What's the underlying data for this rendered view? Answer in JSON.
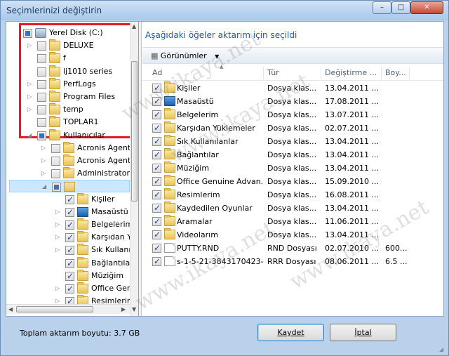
{
  "window": {
    "title": "Seçimlerinizi değiştirin",
    "min_glyph": "–",
    "max_glyph": "□",
    "close_glyph": "✕"
  },
  "tree": [
    {
      "label": "Yerel Disk (C:)",
      "indent": 0,
      "icon": "drive-icon",
      "check": "part",
      "expander": "",
      "sel": false
    },
    {
      "label": "DELUXE",
      "indent": 1,
      "icon": "folder-icon",
      "check": "off",
      "expander": "▷",
      "sel": false
    },
    {
      "label": "f",
      "indent": 1,
      "icon": "folder-icon",
      "check": "off",
      "expander": "",
      "sel": false
    },
    {
      "label": "lj1010 series",
      "indent": 1,
      "icon": "folder-icon",
      "check": "off",
      "expander": "",
      "sel": false
    },
    {
      "label": "PerfLogs",
      "indent": 1,
      "icon": "folder-icon",
      "check": "off",
      "expander": "▷",
      "sel": false
    },
    {
      "label": "Program Files",
      "indent": 1,
      "icon": "folder-icon",
      "check": "off",
      "expander": "▷",
      "sel": false
    },
    {
      "label": "temp",
      "indent": 1,
      "icon": "folder-icon",
      "check": "off",
      "expander": "▷",
      "sel": false
    },
    {
      "label": "TOPLAR1",
      "indent": 1,
      "icon": "folder-icon",
      "check": "off",
      "expander": "",
      "sel": false
    },
    {
      "label": "Kullanıcılar",
      "indent": 1,
      "icon": "folder-icon",
      "check": "part",
      "expander": "◢",
      "sel": false
    },
    {
      "label": "Acronis Agent",
      "indent": 2,
      "icon": "folder-icon",
      "check": "off",
      "expander": "▷",
      "sel": false
    },
    {
      "label": "Acronis Agent",
      "indent": 2,
      "icon": "folder-icon",
      "check": "off",
      "expander": "▷",
      "sel": false
    },
    {
      "label": "Administrator",
      "indent": 2,
      "icon": "folder-icon",
      "check": "off",
      "expander": "▷",
      "sel": false
    },
    {
      "label": "",
      "indent": 2,
      "icon": "user-folder-icon",
      "check": "part",
      "expander": "◢",
      "sel": true
    },
    {
      "label": "Kişiler",
      "indent": 3,
      "icon": "contacts-icon",
      "check": "on",
      "expander": "",
      "sel": false
    },
    {
      "label": "Masaüstü",
      "indent": 3,
      "icon": "desktop-icon",
      "check": "on",
      "expander": "▷",
      "sel": false
    },
    {
      "label": "Belgelerim",
      "indent": 3,
      "icon": "documents-icon",
      "check": "on",
      "expander": "▷",
      "sel": false
    },
    {
      "label": "Karşıdan Y",
      "indent": 3,
      "icon": "downloads-icon",
      "check": "on",
      "expander": "▷",
      "sel": false
    },
    {
      "label": "Sık Kullanı",
      "indent": 3,
      "icon": "favorites-icon",
      "check": "on",
      "expander": "▷",
      "sel": false
    },
    {
      "label": "Bağlantılar",
      "indent": 3,
      "icon": "links-icon",
      "check": "on",
      "expander": "",
      "sel": false
    },
    {
      "label": "Müziğim",
      "indent": 3,
      "icon": "music-icon",
      "check": "on",
      "expander": "",
      "sel": false
    },
    {
      "label": "Office Gen",
      "indent": 3,
      "icon": "folder-icon",
      "check": "on",
      "expander": "▷",
      "sel": false
    },
    {
      "label": "Resimlerin",
      "indent": 3,
      "icon": "pictures-icon",
      "check": "on",
      "expander": "▷",
      "sel": false
    }
  ],
  "right": {
    "header": "Aşağıdaki öğeler aktarım için seçildi",
    "views_label": "Görünümler",
    "views_arrow": "▼",
    "columns": [
      "Ad",
      "Tür",
      "Değiştirme ...",
      "Boy..."
    ],
    "sort_glyph": "▲",
    "rows": [
      {
        "name": "Kişiler",
        "type": "Dosya klas...",
        "date": "13.04.2011 ...",
        "size": "",
        "icon": "contacts-icon"
      },
      {
        "name": "Masaüstü",
        "type": "Dosya klas...",
        "date": "17.08.2011 ...",
        "size": "",
        "icon": "desktop-icon"
      },
      {
        "name": "Belgelerim",
        "type": "Dosya klas...",
        "date": "13.07.2011 ...",
        "size": "",
        "icon": "documents-icon"
      },
      {
        "name": "Karşıdan Yüklemeler",
        "type": "Dosya klas...",
        "date": "02.07.2011 ...",
        "size": "",
        "icon": "downloads-icon"
      },
      {
        "name": "Sık Kullanılanlar",
        "type": "Dosya klas...",
        "date": "13.04.2011 ...",
        "size": "",
        "icon": "favorites-icon"
      },
      {
        "name": "Bağlantılar",
        "type": "Dosya klas...",
        "date": "13.04.2011 ...",
        "size": "",
        "icon": "links-icon"
      },
      {
        "name": "Müziğim",
        "type": "Dosya klas...",
        "date": "13.04.2011 ...",
        "size": "",
        "icon": "music-icon"
      },
      {
        "name": "Office Genuine Advan...",
        "type": "Dosya klas...",
        "date": "15.09.2010 ...",
        "size": "",
        "icon": "folder-icon"
      },
      {
        "name": "Resimlerim",
        "type": "Dosya klas...",
        "date": "16.08.2011 ...",
        "size": "",
        "icon": "pictures-icon"
      },
      {
        "name": "Kaydedilen Oyunlar",
        "type": "Dosya klas...",
        "date": "13.04.2011 ...",
        "size": "",
        "icon": "saved-games-icon"
      },
      {
        "name": "Aramalar",
        "type": "Dosya klas...",
        "date": "11.06.2011 ...",
        "size": "",
        "icon": "searches-icon"
      },
      {
        "name": "Videolarım",
        "type": "Dosya klas...",
        "date": "13.04.2011 ...",
        "size": "",
        "icon": "videos-icon"
      },
      {
        "name": "PUTTY.RND",
        "type": "RND Dosyası",
        "date": "02.07.2010 ...",
        "size": "600...",
        "icon": "file-icon"
      },
      {
        "name": "s-1-5-21-3843170423-...",
        "type": "RRR Dosyası",
        "date": "08.06.2011 ...",
        "size": "6.5 ...",
        "icon": "file-icon"
      }
    ]
  },
  "footer": {
    "total_label": "Toplam aktarım boyutu: 3.7 GB",
    "save_label": "Kaydet",
    "cancel_label": "İptal"
  },
  "watermark": "www.ikaya.net",
  "colors": {
    "highlight_box": "#e31b23",
    "link_blue": "#1e5aa8",
    "selection": "#cce8ff"
  }
}
